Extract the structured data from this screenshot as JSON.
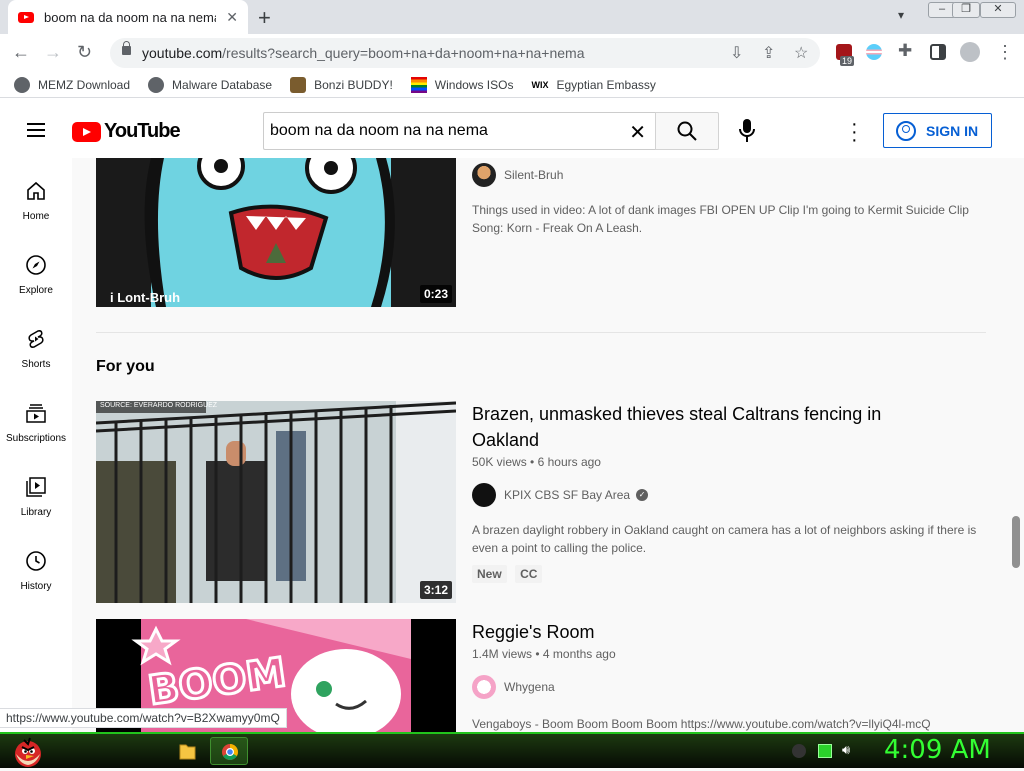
{
  "browser": {
    "tab_title": "boom na da noom na na nema -",
    "url_host": "youtube.com",
    "url_rest": "/results?search_query=boom+na+da+noom+na+na+nema",
    "extension_badge": "19",
    "status_url": "https://www.youtube.com/watch?v=B2Xwamyy0mQ"
  },
  "bookmarks": [
    {
      "label": "MEMZ Download"
    },
    {
      "label": "Malware Database"
    },
    {
      "label": "Bonzi BUDDY!"
    },
    {
      "label": "Windows ISOs"
    },
    {
      "label": "Egyptian Embassy"
    }
  ],
  "bookmark_icon_wix": "WIX",
  "youtube": {
    "logo_text": "YouTube",
    "search_value": "boom na da noom na na nema",
    "signin_label": "SIGN IN"
  },
  "sidebar": {
    "items": [
      {
        "label": "Home"
      },
      {
        "label": "Explore"
      },
      {
        "label": "Shorts"
      },
      {
        "label": "Subscriptions"
      },
      {
        "label": "Library"
      },
      {
        "label": "History"
      }
    ]
  },
  "results": {
    "first": {
      "channel": "Silent-Bruh",
      "description": "Things used in video: A lot of dank images FBI OPEN UP Clip I'm going to Kermit Suicide Clip Song: Korn - Freak On A Leash.",
      "duration": "0:23",
      "thumb_caption": "i Lont-Bruh"
    },
    "section_title": "For you",
    "videos": [
      {
        "title": "Brazen, unmasked thieves steal Caltrans fencing in Oakland",
        "views": "50K views",
        "age": "6 hours ago",
        "channel": "KPIX CBS SF Bay Area",
        "description": "A brazen daylight robbery in Oakland caught on camera has a lot of neighbors asking if there is even a point to calling the police.",
        "badges": [
          "New",
          "CC"
        ],
        "duration": "3:12",
        "thumb_source": "SOURCE: EVERARDO RODRIGUEZ"
      },
      {
        "title": "Reggie's Room",
        "views": "1.4M views",
        "age": "4 months ago",
        "channel": "Whygena",
        "description": "Vengaboys - Boom Boom Boom Boom https://www.youtube.com/watch?v=llyiQ4l-mcQ",
        "thumb_text": "BOOM"
      }
    ]
  },
  "taskbar": {
    "clock": "4:09 AM"
  },
  "colors": {
    "youtube_red": "#ff0000",
    "signin_blue": "#065fd4",
    "clock_green": "#33ff33"
  }
}
